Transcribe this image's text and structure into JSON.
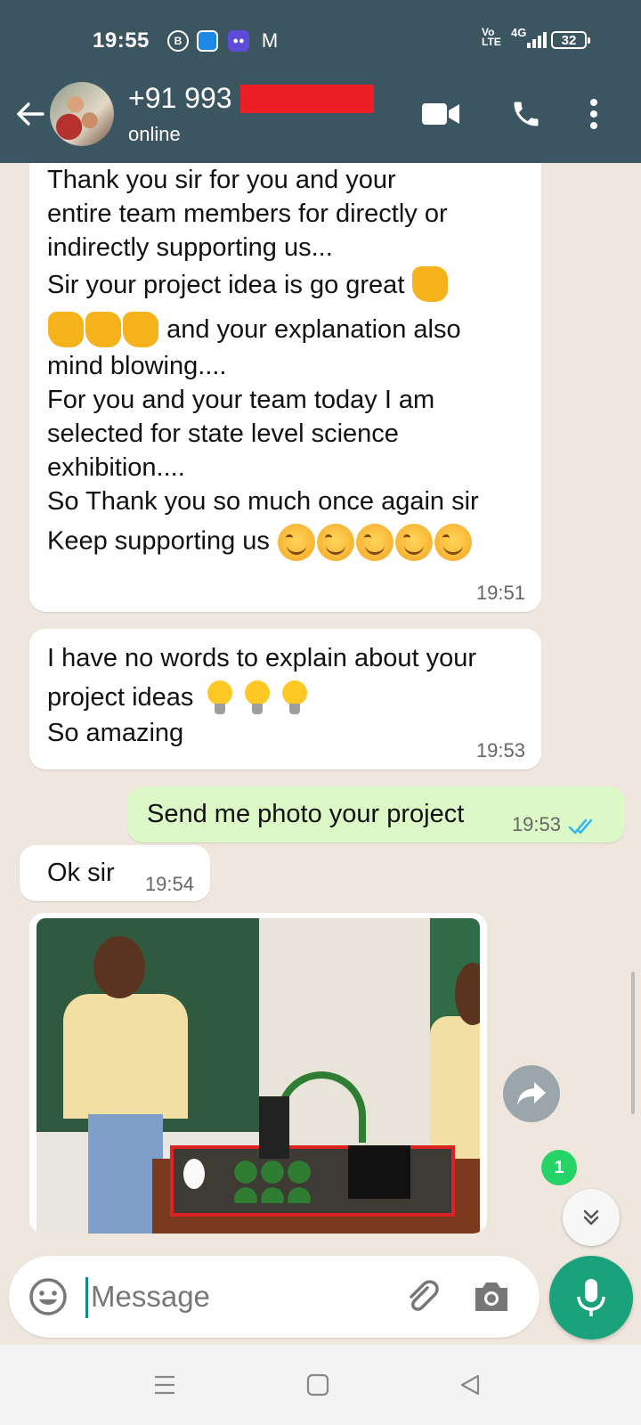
{
  "status_bar": {
    "time": "19:55",
    "notification_icons": [
      "b-icon",
      "blue-app-icon",
      "purple-app-icon",
      "gmail-icon"
    ],
    "network": {
      "volte": "Vo\nLTE",
      "type": "4G"
    },
    "battery": "32"
  },
  "header": {
    "contact_name": "+91 993",
    "contact_status": "online",
    "icons": [
      "back-arrow-icon",
      "video-call-icon",
      "voice-call-icon",
      "more-options-icon"
    ],
    "background_color": "#3b5561"
  },
  "messages": [
    {
      "direction": "incoming",
      "lines": [
        " Thank you sir for you and your",
        "entire team members for directly or",
        "indirectly supporting us...",
        "Sir your project idea is go great",
        "and your explanation also",
        "mind blowing....",
        "For you and your team today I am",
        "selected for state level science",
        "exhibition....",
        "So Thank you so much once again sir",
        "Keep supporting us"
      ],
      "time": "19:51"
    },
    {
      "direction": "incoming",
      "lines": [
        "I have no words to explain about your",
        "project ideas",
        "So amazing"
      ],
      "time": "19:53"
    },
    {
      "direction": "outgoing",
      "text": "Send me photo your project",
      "time": "19:53",
      "read_receipt": "double-check-icon"
    },
    {
      "direction": "incoming",
      "text": "Ok sir",
      "time": "19:54"
    },
    {
      "direction": "incoming",
      "type": "photo"
    }
  ],
  "floating": {
    "unread_count": "1"
  },
  "input": {
    "placeholder": "Message"
  },
  "colors": {
    "chat_background": "#efe7de",
    "outgoing_bubble": "#dcf8c6",
    "accent_green": "#1aa37a",
    "badge_green": "#25d366",
    "redaction": "#ec1f26"
  }
}
